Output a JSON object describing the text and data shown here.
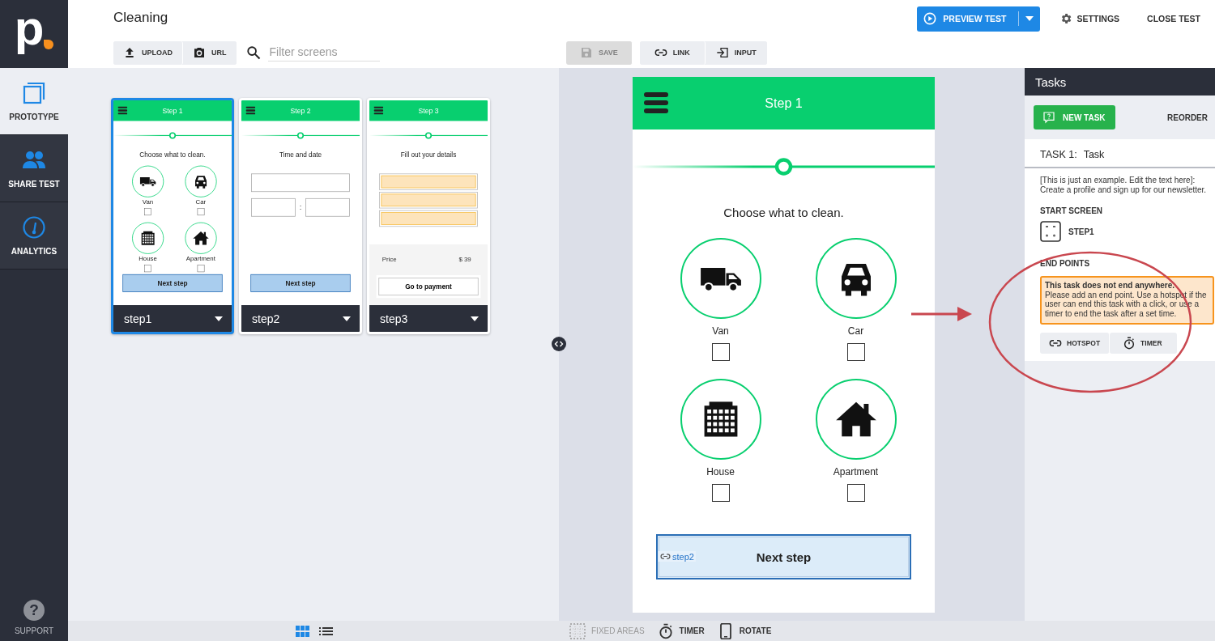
{
  "logo": {
    "letter": "p"
  },
  "sidebar": {
    "items": [
      {
        "label": "PROTOTYPE",
        "selected": true
      },
      {
        "label": "SHARE TEST",
        "selected": false
      },
      {
        "label": "ANALYTICS",
        "selected": false
      }
    ],
    "support": {
      "glyph": "?",
      "label": "SUPPORT"
    }
  },
  "header": {
    "title": "Cleaning",
    "preview_button": "PREVIEW TEST",
    "settings": "SETTINGS",
    "close": "CLOSE TEST"
  },
  "toolbar": {
    "upload": "UPLOAD",
    "url": "URL",
    "filter": {
      "placeholder": "Filter screens"
    },
    "save": {
      "label": "SAVE",
      "disabled": true
    },
    "link": "LINK",
    "input": "INPUT"
  },
  "screens": [
    {
      "name": "step1",
      "selected": true,
      "kind": "choices",
      "level": 0.5,
      "header": "Step 1",
      "heading": "Choose what to clean.",
      "options": [
        {
          "label": "Van",
          "checked": false
        },
        {
          "label": "Car",
          "checked": false
        },
        {
          "label": "House",
          "checked": false
        },
        {
          "label": "Apartment",
          "checked": false
        }
      ],
      "button": "Next step"
    },
    {
      "name": "step2",
      "selected": false,
      "kind": "datetime",
      "level": 0.5,
      "header": "Step 2",
      "heading": "Time and date",
      "separator": ":",
      "button": "Next step"
    },
    {
      "name": "step3",
      "selected": false,
      "kind": "details",
      "level": 0.5,
      "header": "Step 3",
      "heading": "Fill out your details",
      "price_label": "Price",
      "price": "$ 39",
      "button": "Go to payment"
    }
  ],
  "preview": {
    "screen": {
      "kind": "choices",
      "level": 0.5,
      "header": "Step 1",
      "heading": "Choose what to clean.",
      "options": [
        {
          "label": "Van",
          "checked": false
        },
        {
          "label": "Car",
          "checked": false
        },
        {
          "label": "House",
          "checked": false
        },
        {
          "label": "Apartment",
          "checked": false
        }
      ],
      "button": "Next step"
    },
    "link": "step2"
  },
  "tasks": {
    "title": "Tasks",
    "new_task": "NEW TASK",
    "reorder": "REORDER",
    "task": {
      "number": "TASK 1:",
      "name": "Task",
      "description": "[This is just an example. Edit the text here]: Create a profile and sign up for our newsletter.",
      "start_label": "START SCREEN",
      "start_screen": "STEP1",
      "end_label": "END POINTS",
      "warning": {
        "title": "This task does not end anywhere.",
        "text": "Please add an end point. Use a hotspot if the user can end this task with a click, or use a timer to end the task after a set time."
      },
      "hotspot": "HOTSPOT",
      "timer": "TIMER"
    }
  },
  "bottom_bar": {
    "views": [
      {
        "kind": "grid",
        "selected": true
      },
      {
        "kind": "list",
        "selected": false
      }
    ],
    "fixed_areas": {
      "label": "FIXED AREAS",
      "disabled": true
    },
    "timer": "TIMER",
    "rotate": "ROTATE"
  }
}
